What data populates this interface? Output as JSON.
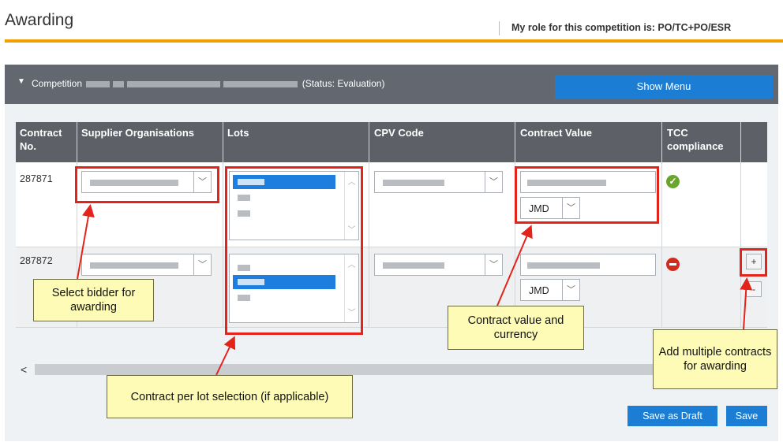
{
  "header": {
    "title": "Awarding",
    "role_text": "My role for this competition is: PO/TC+PO/ESR"
  },
  "competition_bar": {
    "prefix": "Competition",
    "status": "(Status: Evaluation)",
    "show_menu_label": "Show Menu"
  },
  "table": {
    "columns": {
      "contract_no": "Contract No.",
      "supplier": "Supplier Organisations",
      "lots": "Lots",
      "cpv": "CPV Code",
      "value": "Contract Value",
      "tcc": "TCC compliance"
    },
    "rows": [
      {
        "contract_no": "287871",
        "currency": "JMD",
        "tcc_status": "compliant"
      },
      {
        "contract_no": "287872",
        "currency": "JMD",
        "tcc_status": "non-compliant"
      }
    ],
    "add_label": "+",
    "remove_label": "-"
  },
  "scroll": {
    "left_arrow": "<"
  },
  "buttons": {
    "save_draft": "Save as Draft",
    "save": "Save"
  },
  "callouts": {
    "bidder": "Select bidder for awarding",
    "lots": "Contract per lot selection (if applicable)",
    "value": "Contract value and currency",
    "multiple": "Add multiple contracts for awarding"
  },
  "colors": {
    "accent_orange": "#f0a000",
    "primary_blue": "#1b7ed4",
    "annotation_red": "#e4231a",
    "callout_yellow": "#fdfbb5"
  }
}
